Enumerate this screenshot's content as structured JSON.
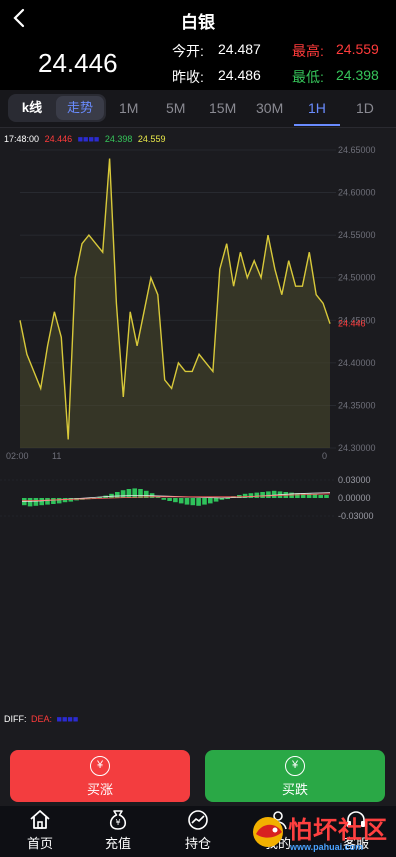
{
  "header": {
    "title": "白银"
  },
  "quote": {
    "last": "24.446",
    "open_label": "今开:",
    "open": "24.487",
    "high_label": "最高:",
    "high": "24.559",
    "prev_label": "昨收:",
    "prev": "24.486",
    "low_label": "最低:",
    "low": "24.398"
  },
  "period_tabs": {
    "kline": "k线",
    "trend": "走势",
    "items": [
      "1M",
      "5M",
      "15M",
      "30M",
      "1H",
      "1D"
    ],
    "active": "1H"
  },
  "legend": {
    "time": "17:48:00",
    "v1": "24.446",
    "v2": "24.398",
    "v3": "24.559"
  },
  "macd_legend": {
    "diff": "DIFF:",
    "dea": "DEA:"
  },
  "actions": {
    "buy_up": "买涨",
    "buy_down": "买跌",
    "currency_symbol": "¥"
  },
  "nav": [
    "首页",
    "充值",
    "持仓",
    "我的",
    "客服"
  ],
  "watermark": {
    "text": "怕坏社区",
    "url": "www.pahuai.com"
  },
  "colors": {
    "up": "#f33d3f",
    "down": "#2aa846",
    "accent": "#6a8cff",
    "line": "#d8c93a"
  },
  "chart_data": {
    "type": "line",
    "ylim": [
      24.3,
      24.65
    ],
    "y_ticks": [
      "24.65000",
      "24.60000",
      "24.55000",
      "24.50000",
      "24.45000",
      "24.40000",
      "24.35000",
      "24.30000"
    ],
    "current_label": "24.446",
    "x_ticks": [
      "02:00",
      "11",
      "0"
    ],
    "values": [
      24.45,
      24.41,
      24.39,
      24.37,
      24.42,
      24.46,
      24.43,
      24.31,
      24.5,
      24.54,
      24.55,
      24.54,
      24.53,
      24.64,
      24.47,
      24.36,
      24.46,
      24.42,
      24.46,
      24.5,
      24.48,
      24.38,
      24.37,
      24.4,
      24.39,
      24.39,
      24.41,
      24.4,
      24.39,
      24.51,
      24.54,
      24.49,
      24.53,
      24.5,
      24.52,
      24.5,
      24.55,
      24.51,
      24.48,
      24.52,
      24.49,
      24.49,
      24.53,
      24.48,
      24.47,
      24.446
    ],
    "macd": {
      "y_ticks": [
        "0.03000",
        "0.00000",
        "-0.03000"
      ],
      "histogram": [
        -0.012,
        -0.014,
        -0.013,
        -0.012,
        -0.011,
        -0.01,
        -0.009,
        -0.007,
        -0.006,
        -0.004,
        -0.003,
        -0.002,
        -0.001,
        0.002,
        0.004,
        0.007,
        0.01,
        0.013,
        0.015,
        0.016,
        0.015,
        0.012,
        0.008,
        0.003,
        -0.003,
        -0.005,
        -0.007,
        -0.009,
        -0.011,
        -0.012,
        -0.013,
        -0.011,
        -0.009,
        -0.006,
        -0.003,
        0.0,
        0.003,
        0.005,
        0.007,
        0.008,
        0.009,
        0.01,
        0.011,
        0.012,
        0.011,
        0.01,
        0.009,
        0.008,
        0.008,
        0.007,
        0.006,
        0.005,
        0.005
      ],
      "diff": [
        -0.006,
        -0.005,
        -0.003,
        -0.001,
        0.001,
        0.003,
        0.004,
        0.004,
        0.003,
        0.002,
        0.001,
        0.0,
        0.001,
        0.003,
        0.005,
        0.007,
        0.008,
        0.009
      ],
      "dea": [
        -0.004,
        -0.004,
        -0.003,
        -0.002,
        -0.001,
        0.0,
        0.001,
        0.002,
        0.002,
        0.002,
        0.002,
        0.002,
        0.002,
        0.003,
        0.004,
        0.005,
        0.006,
        0.007
      ]
    }
  }
}
